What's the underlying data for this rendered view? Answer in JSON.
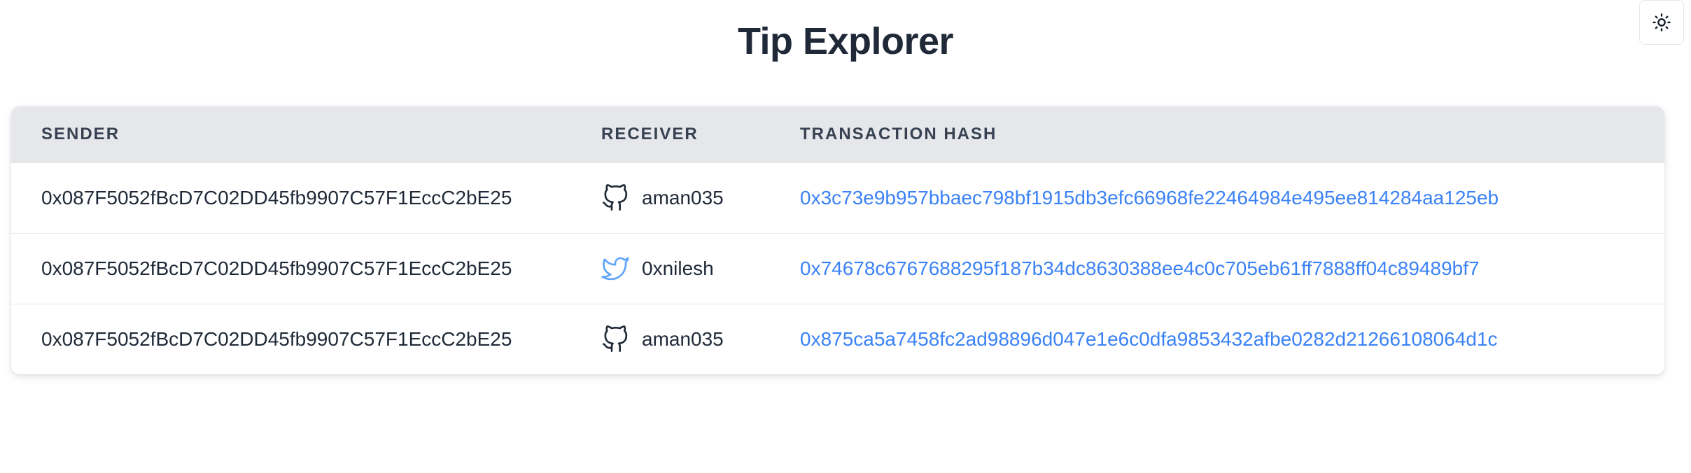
{
  "page": {
    "title": "Tip Explorer"
  },
  "theme_toggle": {
    "icon": "sun-icon"
  },
  "table": {
    "headers": {
      "sender": "SENDER",
      "receiver": "RECEIVER",
      "hash": "TRANSACTION HASH"
    },
    "rows": [
      {
        "sender": "0x087F5052fBcD7C02DD45fb9907C57F1EccC2bE25",
        "receiver_platform": "github-icon",
        "receiver": "aman035",
        "hash": "0x3c73e9b957bbaec798bf1915db3efc66968fe22464984e495ee814284aa125eb"
      },
      {
        "sender": "0x087F5052fBcD7C02DD45fb9907C57F1EccC2bE25",
        "receiver_platform": "twitter-icon",
        "receiver": "0xnilesh",
        "hash": "0x74678c6767688295f187b34dc8630388ee4c0c705eb61ff7888ff04c89489bf7"
      },
      {
        "sender": "0x087F5052fBcD7C02DD45fb9907C57F1EccC2bE25",
        "receiver_platform": "github-icon",
        "receiver": "aman035",
        "hash": "0x875ca5a7458fc2ad98896d047e1e6c0dfa9853432afbe0282d21266108064d1c"
      }
    ]
  },
  "colors": {
    "link": "#3b82f6",
    "twitter": "#60a5fa",
    "header_bg": "#e5e7eb",
    "text": "#1f2937"
  }
}
